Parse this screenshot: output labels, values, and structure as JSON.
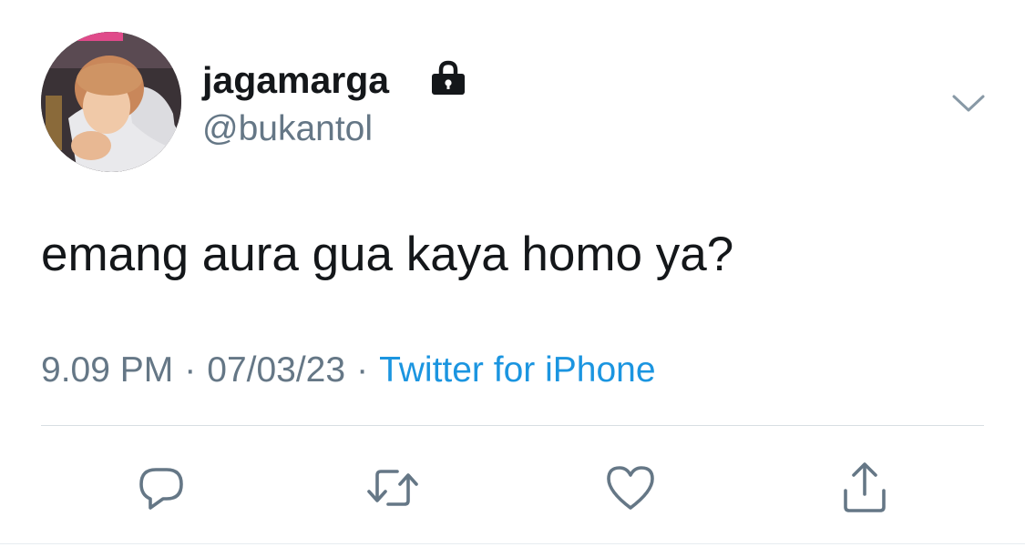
{
  "tweet": {
    "author": {
      "display_name": "jagamarga",
      "handle": "@bukantol",
      "protected_icon": "lock-icon",
      "avatar": "profile-photo"
    },
    "text": "emang aura gua kaya homo ya?",
    "meta": {
      "time": "9.09 PM",
      "separator": "·",
      "date": "07/03/23",
      "source": "Twitter for iPhone"
    },
    "menu_icon": "chevron-down-icon",
    "actions": [
      {
        "name": "reply",
        "icon": "reply-icon"
      },
      {
        "name": "retweet",
        "icon": "retweet-icon"
      },
      {
        "name": "like",
        "icon": "heart-icon"
      },
      {
        "name": "share",
        "icon": "share-icon"
      }
    ]
  },
  "colors": {
    "text_primary": "#14171a",
    "text_secondary": "#657786",
    "link": "#1b95e0",
    "divider": "#d8dee3"
  }
}
